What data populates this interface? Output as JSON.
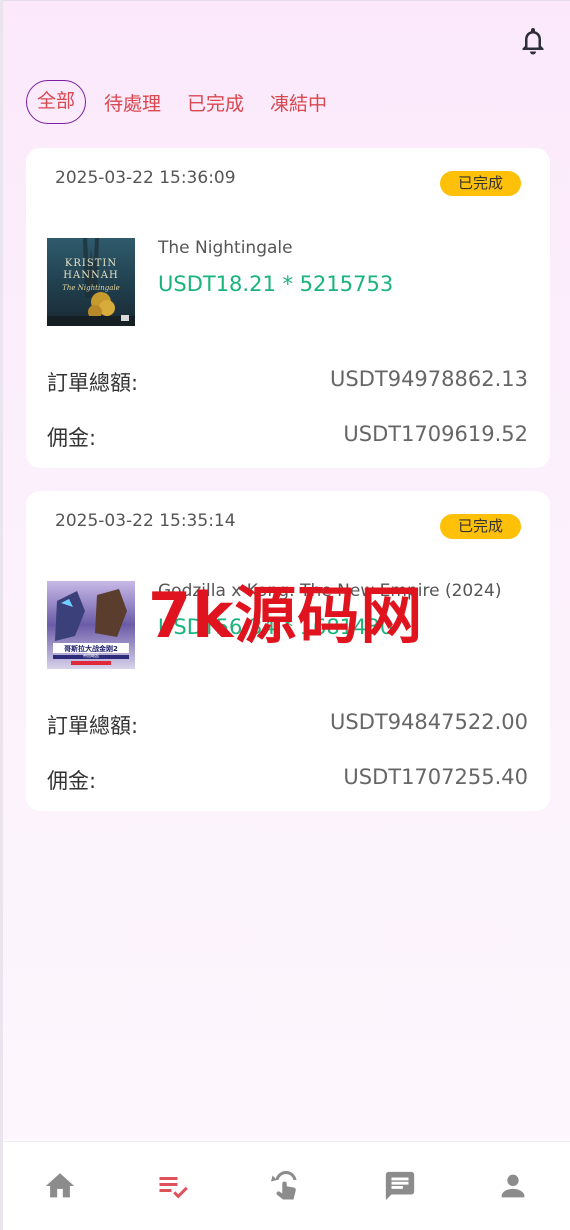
{
  "header": {
    "bell_icon": "bell-icon"
  },
  "tabs": [
    {
      "label": "全部",
      "active": true
    },
    {
      "label": "待處理",
      "active": false
    },
    {
      "label": "已完成",
      "active": false
    },
    {
      "label": "凍結中",
      "active": false
    }
  ],
  "orders": [
    {
      "time": "2025-03-22 15:36:09",
      "status": "已完成",
      "product_name": "The Nightingale",
      "price_line": "USDT18.21 * 5215753",
      "total_label": "訂單總額:",
      "total_value": "USDT94978862.13",
      "commission_label": "佣金:",
      "commission_value": "USDT1709619.52",
      "thumb_text": [
        "KRISTIN",
        "HANNAH",
        "The Nightingale"
      ]
    },
    {
      "time": "2025-03-22 15:35:14",
      "status": "已完成",
      "product_name": "Godzilla x Kong: The New Empire (2024)",
      "price_line": "USDT56.34 * 1681430",
      "total_label": "訂單總額:",
      "total_value": "USDT94847522.00",
      "commission_label": "佣金:",
      "commission_value": "USDT1707255.40",
      "thumb_text": [
        "哥斯拉大战金刚2",
        "帝国崛起"
      ]
    }
  ],
  "watermark": "7k源码网",
  "bottom_nav": [
    {
      "icon": "home-icon",
      "active": false
    },
    {
      "icon": "orders-icon",
      "active": true
    },
    {
      "icon": "tap-icon",
      "active": false
    },
    {
      "icon": "message-icon",
      "active": false
    },
    {
      "icon": "profile-icon",
      "active": false
    }
  ],
  "colors": {
    "accent_red": "#d9474f",
    "tab_border": "#7b1fa2",
    "price_green": "#19b47c",
    "badge_yellow": "#ffc107",
    "nav_grey": "#8c8c8c"
  }
}
